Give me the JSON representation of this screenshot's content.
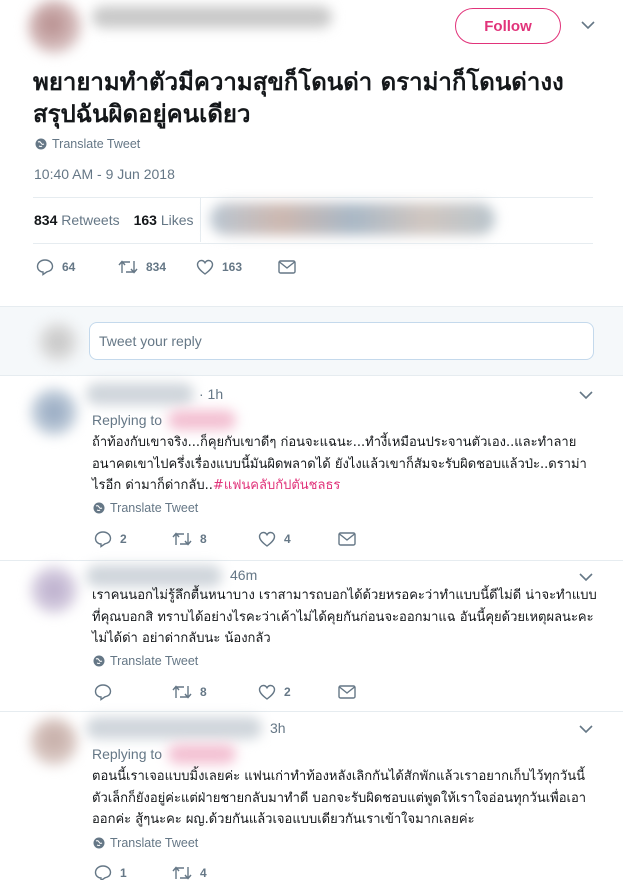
{
  "main_tweet": {
    "follow_label": "Follow",
    "text": "พยายามทำตัวมีความสุขก็โดนด่า ดราม่าก็โดนด่างง สรุปฉันผิดอยู่คนเดียว",
    "translate_label": "Translate Tweet",
    "timestamp": "10:40 AM - 9 Jun 2018",
    "retweets_count": "834",
    "retweets_label": "Retweets",
    "likes_count": "163",
    "likes_label": "Likes",
    "actions": {
      "replies": "64",
      "retweets": "834",
      "likes": "163"
    }
  },
  "reply_box": {
    "placeholder": "Tweet your reply"
  },
  "replies": [
    {
      "time": "· 1h",
      "replying_to": "Replying to",
      "text": "ถ้าท้องกับเขาจริง...ก็คุยกับเขาดีๆ ก่อนจะแฉนะ...ทำงี้เหมือนประจานตัวเอง..และทำลายอนาคตเขาไปครึ่งเรื่องแบบนี้มันผิดพลาดได้ ยังไงแล้วเขาก็สัมจะรับผิดชอบแล้วป่ะ..ดราม่าไรอีก ด่ามาก็ด่ากลับ..",
      "hashtag": "#แฟนคลับกัปตันชลธร",
      "translate_label": "Translate Tweet",
      "actions": {
        "replies": "2",
        "retweets": "8",
        "likes": "4"
      }
    },
    {
      "time": "46m",
      "text": "เราคนนอกไม่รู้ลึกตื้นหนาบาง เราสามารถบอกได้ด้วยหรอคะว่าทำแบบนี้ดีไม่ดี น่าจะทำแบบที่คุณบอกสิ ทราบได้อย่างไรคะว่าเค้าไม่ได้คุยกันก่อนจะออกมาแฉ อันนี้คุยด้วยเหตุผลนะคะ ไม่ได้ด่า อย่าด่ากลับนะ น้องกลัว",
      "translate_label": "Translate Tweet",
      "actions": {
        "replies": "",
        "retweets": "8",
        "likes": "2"
      }
    },
    {
      "time": "3h",
      "replying_to": "Replying to",
      "text": "ตอนนี้เราเจอแบบมิ้งเลยค่ะ แฟนเก่าทำท้องหลังเลิกกันได้สักพักแล้วเราอยากเก็บไว้ทุกวันนี้ตัวเล็กก็ยังอยู่ค่ะแต่ฝ่ายชายกลับมาทำดี บอกจะรับผิดชอบแต่พูดให้เราใจอ่อนทุกวันเพื่อเอาออกค่ะ สู้ๆนะคะ ผญ.ด้วยกันแล้วเจอแบบเดียวกันเราเข้าใจมากเลยค่ะ",
      "translate_label": "Translate Tweet",
      "actions": {
        "replies": "1",
        "retweets": "4",
        "likes": ""
      }
    }
  ],
  "colors": {
    "accent": "#e1337a",
    "muted": "#657786",
    "text": "#14171a",
    "divider": "#e6ecf0"
  }
}
